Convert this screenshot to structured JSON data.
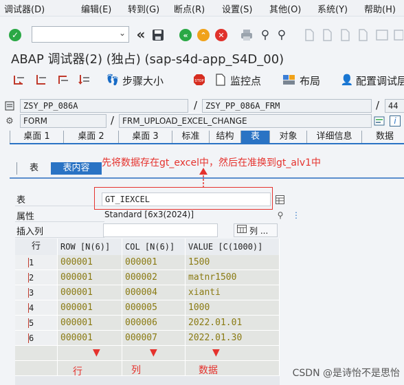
{
  "menu": [
    "调试器(D)",
    "编辑(E)",
    "转到(G)",
    "断点(R)",
    "设置(S)",
    "其他(O)",
    "系统(Y)",
    "帮助(H)"
  ],
  "toolbar": {
    "command_field_value": ""
  },
  "window_title": "ABAP 调试器(2)  (独占) (sap-s4d-app_S4D_00)",
  "app_toolbar": {
    "step_size": "步骤大小",
    "watchpoint": "监控点",
    "layout": "布局",
    "config": "配置调试层"
  },
  "program": {
    "main": "ZSY_PP_086A",
    "include": "ZSY_PP_086A_FRM",
    "line": "44",
    "event_type": "FORM",
    "event_name": "FRM_UPLOAD_EXCEL_CHANGE"
  },
  "tabs": [
    "桌面 1",
    "桌面 2",
    "桌面 3",
    "标准",
    "结构",
    "表",
    "对象",
    "详细信息",
    "数据"
  ],
  "active_tab": "表",
  "inner_tabs": [
    "表",
    "表内容"
  ],
  "annotation_top": "先将数据存在gt_excel中，然后在准换到gt_alv1中",
  "form": {
    "table_label": "表",
    "table_value": "GT_IEXCEL",
    "attr_label": "属性",
    "attr_value": "Standard [6x3(2024)]",
    "insert_label": "插入列",
    "insert_value": "",
    "columns_button": "列 ..."
  },
  "table": {
    "headers": [
      "行",
      "ROW [N(6)]",
      "COL [N(6)]",
      "VALUE [C(1000)]"
    ],
    "rows": [
      [
        "1",
        "000001",
        "000001",
        "1500"
      ],
      [
        "2",
        "000001",
        "000002",
        "matnr1500"
      ],
      [
        "3",
        "000001",
        "000004",
        "xianti"
      ],
      [
        "4",
        "000001",
        "000005",
        "1000"
      ],
      [
        "5",
        "000001",
        "000006",
        "2022.01.01"
      ],
      [
        "6",
        "000001",
        "000007",
        "2022.01.30"
      ]
    ]
  },
  "annotations_bottom": [
    "行",
    "列",
    "数据"
  ],
  "watermark": "CSDN @是诗怡不是思怡",
  "colors": {
    "accent": "#2a73c4",
    "annotation_red": "#e5322d",
    "cell_text": "#8a7a12"
  }
}
